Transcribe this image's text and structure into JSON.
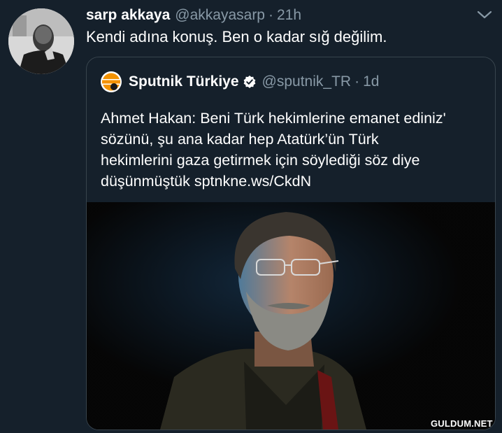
{
  "tweet": {
    "author_name": "sarp akkaya",
    "author_handle": "@akkayasarp",
    "separator": "·",
    "time": "21h",
    "text": "Kendi adına konuş. Ben o kadar sığ değilim.",
    "menu_icon": "chevron-down-icon",
    "avatar": "profile-photo"
  },
  "quoted_tweet": {
    "author_name": "Sputnik Türkiye",
    "verified_icon": "verified-badge-icon",
    "author_handle": "@sputnik_TR",
    "separator": "·",
    "time": "1d",
    "text_lines": [
      "Ahmet Hakan: Beni Türk hekimlerine emanet ediniz'",
      "sözünü, şu ana kadar hep Atatürk’ün Türk",
      "hekimlerini gaza getirmek için söylediği söz diye",
      "düşünmüştük sptnkne.ws/CkdN"
    ],
    "media": "portrait-photo"
  },
  "watermark": "GULDUM.NET",
  "colors": {
    "background": "#15202b",
    "border": "#38444d",
    "secondary_text": "#8899a6",
    "primary_text": "#ffffff",
    "verified_blue": "#ffffff",
    "sputnik_orange": "#f39200"
  }
}
